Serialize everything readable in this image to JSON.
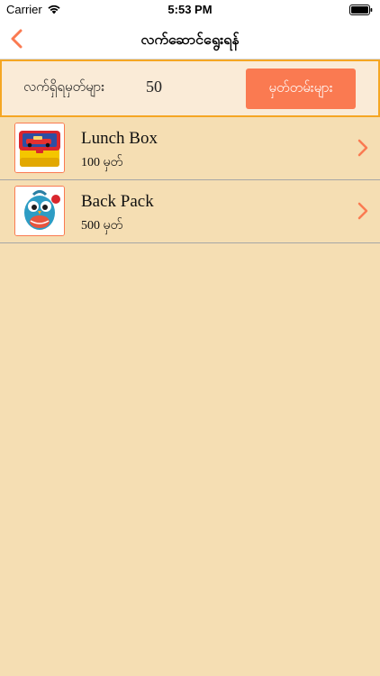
{
  "status_bar": {
    "carrier": "Carrier",
    "time": "5:53 PM"
  },
  "nav": {
    "title": "လက်ဆောင်ရွေးရန်",
    "back_icon": "chevron-left-icon"
  },
  "points": {
    "label": "လက်ရှိရမှတ်များ",
    "value": "50",
    "history_button": "မှတ်တမ်းများ"
  },
  "gifts": [
    {
      "name": "Lunch Box",
      "points": "100 မှတ်",
      "icon": "lunch-box-image"
    },
    {
      "name": "Back Pack",
      "points": "500 မှတ်",
      "icon": "backpack-image"
    }
  ],
  "colors": {
    "background": "#f5deb3",
    "accent": "#fa7a51",
    "panel_border": "#f5a623",
    "panel_background": "#faebd7"
  }
}
